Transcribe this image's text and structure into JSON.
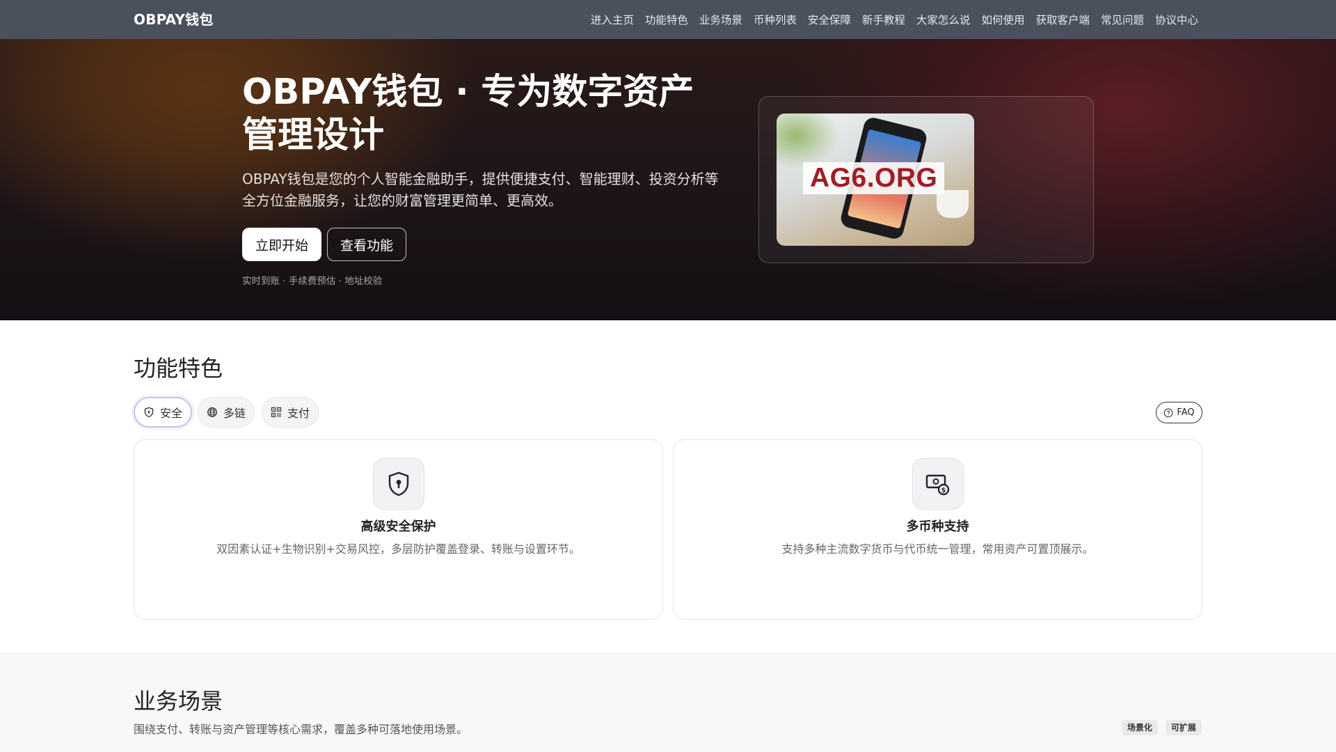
{
  "nav": {
    "brand": "OBPAY钱包",
    "items": [
      "进入主页",
      "功能特色",
      "业务场景",
      "币种列表",
      "安全保障",
      "新手教程",
      "大家怎么说",
      "如何使用",
      "获取客户端",
      "常见问题",
      "协议中心"
    ]
  },
  "hero": {
    "title": "OBPAY钱包 · 专为数字资产管理设计",
    "description": "OBPAY钱包是您的个人智能金融助手，提供便捷支付、智能理财、投资分析等全方位金融服务，让您的财富管理更简单、更高效。",
    "primary_button": "立即开始",
    "secondary_button": "查看功能",
    "note": "实时到账 · 手续费预估 · 地址校验",
    "image_watermark": "AG6.ORG"
  },
  "features": {
    "title": "功能特色",
    "tabs": [
      {
        "label": "安全",
        "icon": "shield-icon",
        "active": true
      },
      {
        "label": "多链",
        "icon": "globe-icon",
        "active": false
      },
      {
        "label": "支付",
        "icon": "qr-code-icon",
        "active": false
      }
    ],
    "faq_label": "FAQ",
    "cards": [
      {
        "title": "高级安全保护",
        "description": "双因素认证+生物识别+交易风控，多层防护覆盖登录、转账与设置环节。",
        "icon": "shield-lock-icon"
      },
      {
        "title": "多币种支持",
        "description": "支持多种主流数字货币与代币统一管理，常用资产可置顶展示。",
        "icon": "currency-exchange-icon"
      }
    ]
  },
  "scenes": {
    "title": "业务场景",
    "description": "围绕支付、转账与资产管理等核心需求，覆盖多种可落地使用场景。",
    "tags": [
      "场景化",
      "可扩展"
    ]
  },
  "colors": {
    "nav_bg": "#4b505d",
    "hero_dark": "#1c1418",
    "watermark_red": "#a01d26",
    "active_chip_border": "#c9c1f0"
  }
}
